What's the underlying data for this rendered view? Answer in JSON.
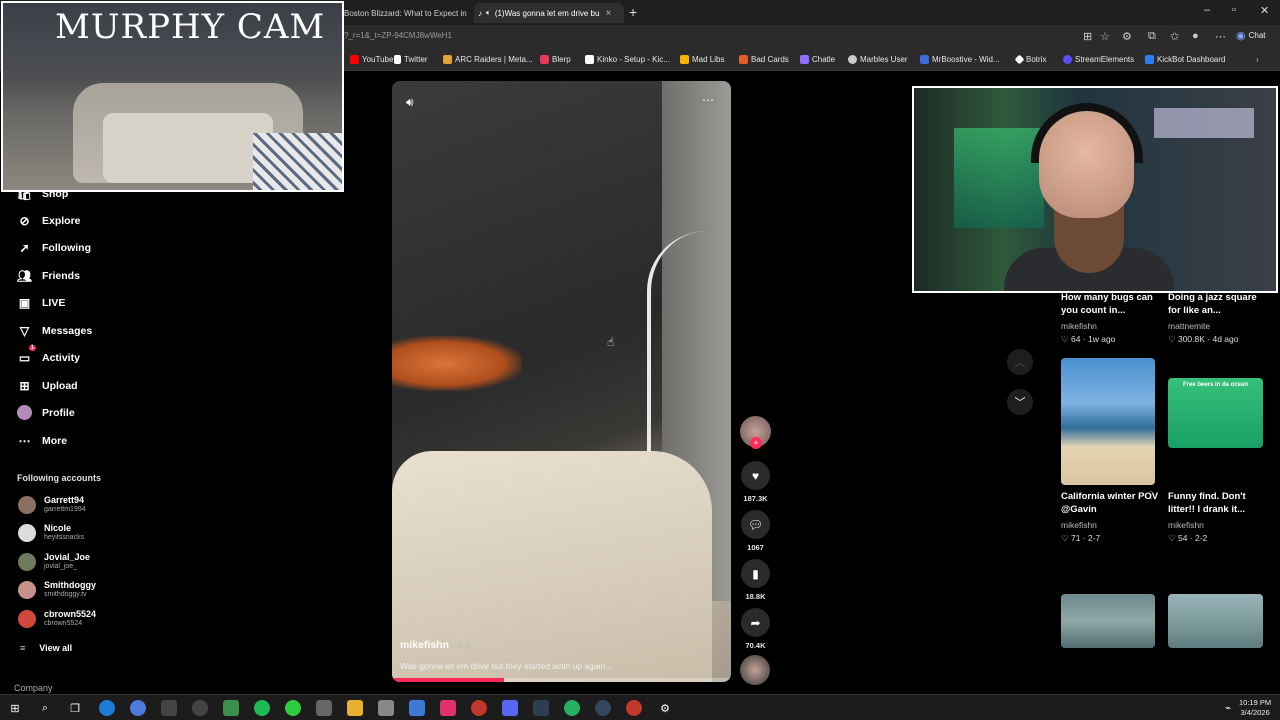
{
  "browser": {
    "tabs": [
      {
        "label": "Boston Blizzard: What to Expect in"
      },
      {
        "label": "(1)Was gonna let em drive bu"
      }
    ],
    "url": "?_r=1&_t=ZP-94CMJ8wWeH1",
    "chat_label": "Chat",
    "bookmarks": [
      {
        "label": "YouTube",
        "color": "#ff0000"
      },
      {
        "label": "Twitter",
        "color": "#ffffff"
      },
      {
        "label": "ARC Raiders | Meta...",
        "color": "#e0a43a"
      },
      {
        "label": "Blerp",
        "color": "#e8365d"
      },
      {
        "label": "Kinko - Setup - Kic...",
        "color": "#ffffff"
      },
      {
        "label": "Mad Libs",
        "color": "#f5b400"
      },
      {
        "label": "Bad Cards",
        "color": "#e65a2e"
      },
      {
        "label": "Chatle",
        "color": "#8f6fff"
      },
      {
        "label": "Marbles User",
        "color": "#cccccc"
      },
      {
        "label": "MrBoostive - Wid...",
        "color": "#3a6bd8"
      },
      {
        "label": "Botrix",
        "color": "#ffffff"
      },
      {
        "label": "StreamElements",
        "color": "#5b4dff"
      },
      {
        "label": "KickBot Dashboard",
        "color": "#2d7df0"
      }
    ]
  },
  "murphy_cam": {
    "title": "MURPHY CAM"
  },
  "sidebar": {
    "items": [
      {
        "label": "Shop",
        "icon": "shop-icon"
      },
      {
        "label": "Explore",
        "icon": "compass-icon"
      },
      {
        "label": "Following",
        "icon": "arrow-icon"
      },
      {
        "label": "Friends",
        "icon": "people-icon"
      },
      {
        "label": "LIVE",
        "icon": "live-icon"
      },
      {
        "label": "Messages",
        "icon": "send-icon"
      },
      {
        "label": "Activity",
        "icon": "bell-icon",
        "badge": "1"
      },
      {
        "label": "Upload",
        "icon": "upload-icon"
      },
      {
        "label": "Profile",
        "icon": "avatar-icon"
      },
      {
        "label": "More",
        "icon": "more-icon"
      }
    ],
    "following_header": "Following accounts",
    "accounts": [
      {
        "name": "Garrett94",
        "handle": "garrettm1994"
      },
      {
        "name": "Nicole",
        "handle": "heyitssnacks"
      },
      {
        "name": "Jovial_Joe",
        "handle": "jovial_joe_"
      },
      {
        "name": "Smithdoggy",
        "handle": "smithdoggy.tv"
      },
      {
        "name": "cbrown5524",
        "handle": "cbrown5524"
      }
    ],
    "view_all": "View all",
    "company": "Company"
  },
  "video": {
    "author": "mikefishn",
    "date": "· 2-2",
    "caption": "Was gonna let em drive but they started actin up again...",
    "progress": 0.33,
    "likes": "187.3K",
    "comments": "1067",
    "saves": "18.8K",
    "shares": "70.4K"
  },
  "recommendations": [
    {
      "title": "How many bugs can you count in...",
      "author": "mikefishn",
      "stats": "♡ 64 · 1w ago"
    },
    {
      "title": "Doing a jazz square for like an...",
      "author": "mattnemite",
      "stats": "♡ 300.8K · 4d ago"
    },
    {
      "title": "California winter POV @Gavin",
      "author": "mikefishn",
      "stats": "♡ 71 · 2-7"
    },
    {
      "title": "Funny find. Don't litter!! I drank it...",
      "author": "mikefishn",
      "stats": "♡ 54 · 2-2"
    }
  ],
  "thumb_caption": "Free beers in da ocean",
  "taskbar": {
    "time": "10:19 PM",
    "date": "3/4/2026"
  }
}
